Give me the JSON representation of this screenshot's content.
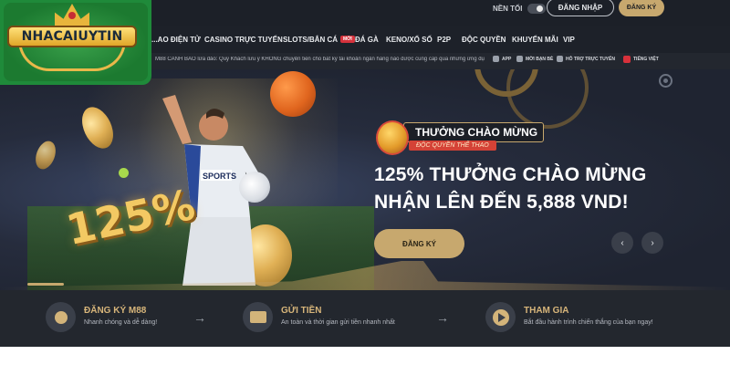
{
  "header": {
    "dark_mode_label": "NỀN TỐI",
    "login_label": "ĐĂNG NHẬP",
    "register_label": "ĐĂNG KÝ"
  },
  "logo": {
    "text": "NHACAIUYTIN"
  },
  "nav": {
    "items": [
      {
        "label": "...AO ĐIỆN TỬ"
      },
      {
        "label": "CASINO TRỰC TUYẾN"
      },
      {
        "label": "SLOTS/BẮN CÁ",
        "badge": "MỚI"
      },
      {
        "label": "ĐÁ GÀ"
      },
      {
        "label": "KENO/XỔ SỐ"
      },
      {
        "label": "P2P"
      },
      {
        "label": "ĐỘC QUYỀN"
      },
      {
        "label": "KHUYẾN MÃI"
      },
      {
        "label": "VIP"
      }
    ]
  },
  "notice": {
    "marquee": "M88 CẢNH BÁO lừa đảo: Quý Khách lưu ý KHÔNG chuyển tiền cho bất kỳ tài khoản ngân hàng nào được cung cấp qua những ứng dụ",
    "links": [
      {
        "label": "APP"
      },
      {
        "label": "MỜI BẠN BÈ"
      },
      {
        "label": "HỖ TRỢ TRỰC TUYẾN"
      },
      {
        "label": "TIẾNG VIỆT"
      }
    ]
  },
  "banner": {
    "badge_title": "THƯỞNG CHÀO MỪNG",
    "badge_subtitle": "ĐỘC QUYỀN THỂ THAO",
    "percent": "125%",
    "headline_line1": "125% THƯỞNG CHÀO MỪNG",
    "headline_line2": "NHẬN LÊN ĐẾN 5,888 VND!",
    "cta_label": "ĐĂNG KÝ",
    "prev_icon": "‹",
    "next_icon": "›",
    "jersey_text": "SPORTS"
  },
  "steps": [
    {
      "title": "ĐĂNG KÝ M88",
      "desc": "Nhanh chóng và dễ dàng!"
    },
    {
      "title": "GỬI TIỀN",
      "desc": "An toàn và thời gian gửi tiền nhanh nhất"
    },
    {
      "title": "THAM GIA",
      "desc": "Bắt đầu hành trình chiến thắng của bạn ngay!"
    }
  ],
  "colors": {
    "accent_gold": "#c7a86e",
    "dark_bg": "#1c2028",
    "badge_red": "#d6323c"
  }
}
